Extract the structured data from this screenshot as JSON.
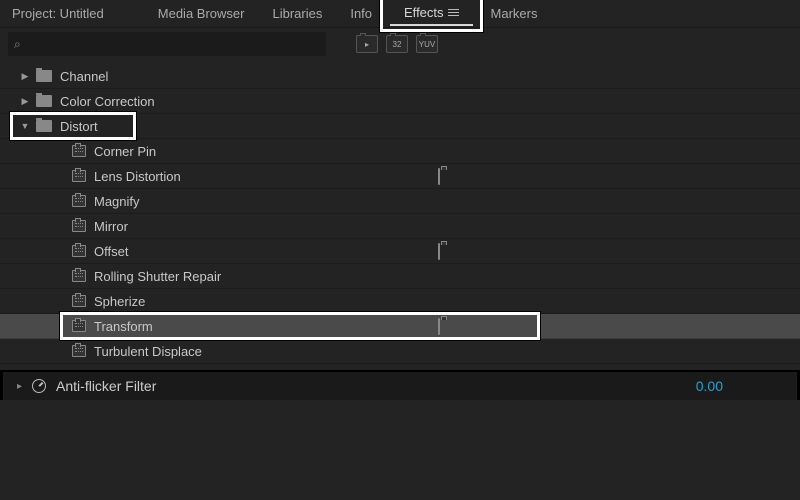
{
  "tabs": {
    "project": "Project: Untitled",
    "media_browser": "Media Browser",
    "libraries": "Libraries",
    "info": "Info",
    "effects": "Effects",
    "markers": "Markers"
  },
  "search": {
    "placeholder": ""
  },
  "badges": {
    "accel": "▸",
    "bit32": "32",
    "yuv": "YUV"
  },
  "tree": {
    "channel": "Channel",
    "color_correction": "Color Correction",
    "distort": "Distort",
    "items": {
      "corner_pin": "Corner Pin",
      "lens_distortion": "Lens Distortion",
      "magnify": "Magnify",
      "mirror": "Mirror",
      "offset": "Offset",
      "rolling_shutter": "Rolling Shutter Repair",
      "spherize": "Spherize",
      "transform": "Transform",
      "turbulent_displace": "Turbulent Displace"
    }
  },
  "bottom": {
    "label": "Anti-flicker Filter",
    "value": "0.00"
  }
}
